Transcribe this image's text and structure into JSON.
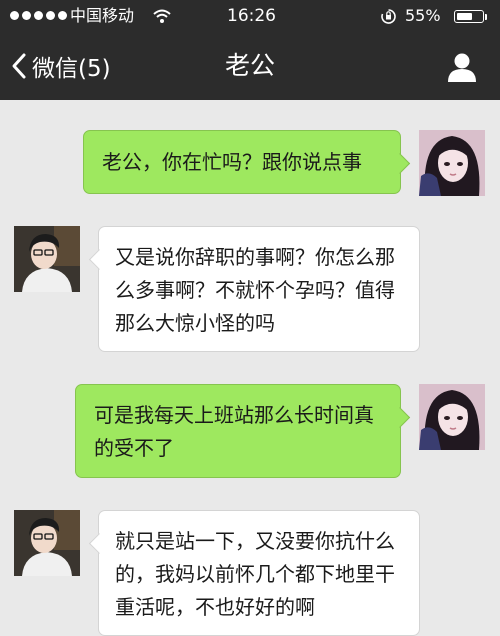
{
  "status": {
    "carrier": "中国移动",
    "time": "16:26",
    "battery_percent": "55%",
    "battery_level": 0.55,
    "icons": [
      "signal-dots-icon",
      "wifi-icon",
      "rotation-lock-icon",
      "battery-icon"
    ]
  },
  "nav": {
    "back_label": "微信(5)",
    "title": "老公",
    "icons": [
      "chevron-left-icon",
      "user-profile-icon"
    ]
  },
  "messages": [
    {
      "sender": "me",
      "text": "老公，你在忙吗？跟你说点事"
    },
    {
      "sender": "them",
      "text": "又是说你辞职的事啊？你怎么那么多事啊？不就怀个孕吗？值得那么大惊小怪的吗"
    },
    {
      "sender": "me",
      "text": "可是我每天上班站那么长时间真的受不了"
    },
    {
      "sender": "them",
      "text": "就只是站一下，又没要你抗什么的，我妈以前怀几个都下地里干重活呢，不也好好的啊"
    }
  ],
  "colors": {
    "bar": "#2c2c2c",
    "background": "#e9e9e9",
    "my_bubble": "#9ee85f",
    "their_bubble": "#ffffff"
  }
}
